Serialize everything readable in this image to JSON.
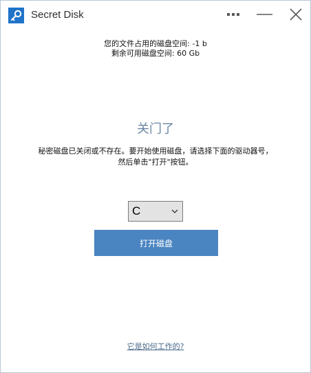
{
  "window": {
    "title": "Secret Disk",
    "logo_icon": "key-icon"
  },
  "titlebar_buttons": {
    "more_icon": "more-icon",
    "minimize_icon": "minimize-icon",
    "close_icon": "close-icon"
  },
  "usage": {
    "used": "您的文件占用的磁盘空间: -1 b",
    "free": "剩余可用磁盘空间: 60 Gb"
  },
  "status": {
    "heading": "关门了",
    "line1": "秘密磁盘已关闭或不存在。要开始使用磁盘，请选择下面的驱动器号，",
    "line2": "然后单击\"打开\"按钮。"
  },
  "drive_select": {
    "value": "C",
    "icon": "chevron-down-icon"
  },
  "open_button": {
    "label": "打开磁盘"
  },
  "help_link": {
    "label": "它是如何工作的?"
  },
  "colors": {
    "accent": "#4a84c1",
    "logo": "#1f74c9",
    "heading": "#6a87a3",
    "link": "#4d6b8c"
  }
}
